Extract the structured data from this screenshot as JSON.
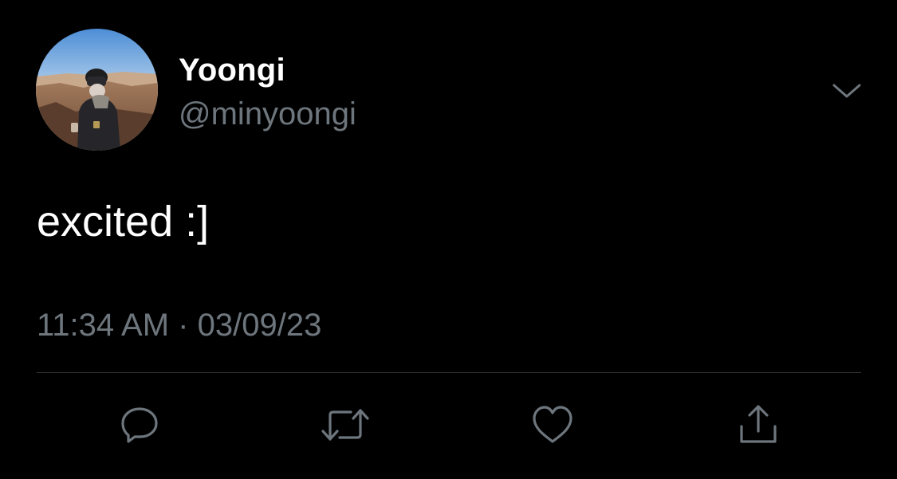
{
  "tweet": {
    "author": {
      "display_name": "Yoongi",
      "handle": "@minyoongi"
    },
    "text": "excited :]",
    "time": "11:34 AM",
    "separator": "·",
    "date": "03/09/23"
  },
  "icons": {
    "more": "chevron-down-icon",
    "reply": "reply-icon",
    "retweet": "retweet-icon",
    "like": "heart-icon",
    "share": "share-icon"
  },
  "colors": {
    "background": "#000000",
    "primary_text": "#ffffff",
    "secondary_text": "#6e767d",
    "divider": "#2f3336"
  }
}
